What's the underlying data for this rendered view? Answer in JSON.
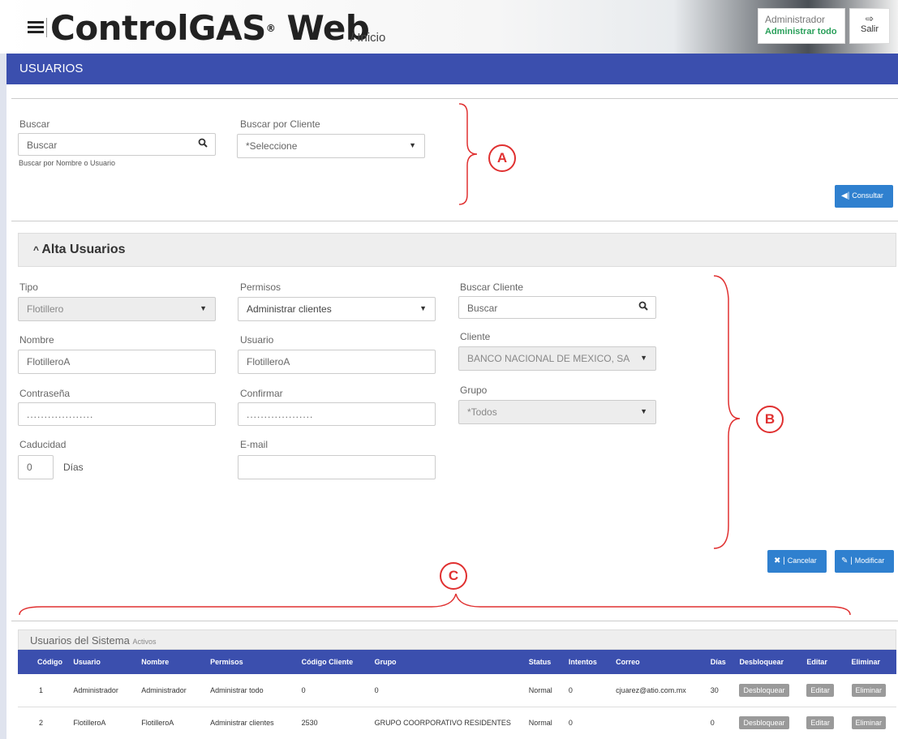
{
  "header": {
    "brand": "ControlGAS",
    "brand_mark": "®",
    "brand_suffix": "Web",
    "breadcrumb": "/ Inicio",
    "user_role": "Administrador",
    "user_permission": "Administrar todo",
    "logout_label": "Salir"
  },
  "section_title": "USUARIOS",
  "search": {
    "buscar_label": "Buscar",
    "buscar_placeholder": "Buscar",
    "buscar_hint": "Buscar por Nombre o Usuario",
    "cliente_label": "Buscar por Cliente",
    "cliente_value": "*Seleccione",
    "consultar_label": "Consultar"
  },
  "form": {
    "title": "Alta Usuarios",
    "tipo_label": "Tipo",
    "tipo_value": "Flotillero",
    "permisos_label": "Permisos",
    "permisos_value": "Administrar clientes",
    "buscar_cliente_label": "Buscar Cliente",
    "buscar_cliente_placeholder": "Buscar",
    "nombre_label": "Nombre",
    "nombre_value": "FlotilleroA",
    "usuario_label": "Usuario",
    "usuario_value": "FlotilleroA",
    "cliente_label": "Cliente",
    "cliente_value": "BANCO NACIONAL DE MEXICO, SA",
    "password_label": "Contraseña",
    "password_value": "...................",
    "confirmar_label": "Confirmar",
    "confirmar_value": "...................",
    "grupo_label": "Grupo",
    "grupo_value": "*Todos",
    "caducidad_label": "Caducidad",
    "caducidad_value": "0",
    "dias_label": "Días",
    "email_label": "E-mail",
    "email_value": "",
    "cancelar_label": "Cancelar",
    "modificar_label": "Modificar"
  },
  "annotations": [
    "A",
    "B",
    "C"
  ],
  "table": {
    "title": "Usuarios del Sistema",
    "subtitle": "Activos",
    "columns": [
      "Código",
      "Usuario",
      "Nombre",
      "Permisos",
      "Código Cliente",
      "Grupo",
      "Status",
      "Intentos",
      "Correo",
      "Días",
      "Desbloquear",
      "Editar",
      "Eliminar"
    ],
    "rows": [
      [
        "1",
        "Administrador",
        "Administrador",
        "Administrar todo",
        "0",
        "0",
        "Normal",
        "0",
        "cjuarez@atio.com.mx",
        "30",
        "Desbloquear",
        "Editar",
        "Eliminar"
      ],
      [
        "2",
        "FlotilleroA",
        "FlotilleroA",
        "Administrar clientes",
        "2530",
        "GRUPO COORPORATIVO RESIDENTES",
        "Normal",
        "0",
        "",
        "0",
        "Desbloquear",
        "Editar",
        "Eliminar"
      ]
    ]
  },
  "colors": {
    "primary_bar": "#3b4fae",
    "button_blue": "#2f80cf",
    "annotation_red": "#e03030",
    "permission_green": "#2aa05b"
  }
}
